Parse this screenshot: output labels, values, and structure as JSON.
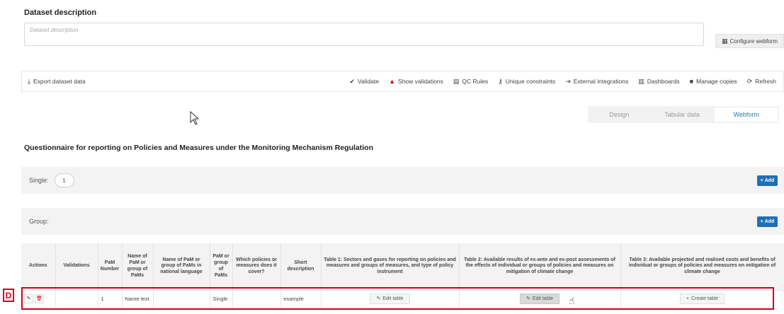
{
  "dataset": {
    "title": "Dataset description",
    "placeholder": "Dataset description",
    "configure_label": "Configure webform"
  },
  "toolbar": {
    "export_label": "Export dataset data",
    "items": [
      {
        "label": "Validate",
        "icon": "check-circle-icon"
      },
      {
        "label": "Show validations",
        "icon": "warning-icon"
      },
      {
        "label": "QC Rules",
        "icon": "document-icon"
      },
      {
        "label": "Unique constraints",
        "icon": "key-icon"
      },
      {
        "label": "External integrations",
        "icon": "plug-icon"
      },
      {
        "label": "Dashboards",
        "icon": "bar-chart-icon"
      },
      {
        "label": "Manage copies",
        "icon": "copy-icon"
      },
      {
        "label": "Refresh",
        "icon": "refresh-icon"
      }
    ]
  },
  "view_tabs": [
    {
      "label": "Design",
      "active": false
    },
    {
      "label": "Tabular data",
      "active": false
    },
    {
      "label": "Webform",
      "active": true
    }
  ],
  "questionnaire": {
    "title": "Questionnaire for reporting on Policies and Measures under the Monitoring Mechanism Regulation",
    "single_label": "Single:",
    "single_count": "1",
    "group_label": "Group:",
    "add_label": "Add"
  },
  "table": {
    "headers": [
      "Actions",
      "Validations",
      "PaM Number",
      "Name of PaM or group of PaMs",
      "Name of PaM or group of PaMs in national language",
      "PaM or group of PaMs",
      "Which policies or measures does it cover?",
      "Short description",
      "Table 1: Sectors and gases for reporting on policies and measures and groups of measures, and type of policy instrument",
      "Table 2: Available results of ex-ante and ex-post assessments of the effects of individual or groups of policies and measures on mitigation of climate change",
      "Table 3: Available projected and realised costs and benefits of individual or groups of policies and measures on mitigation of climate change"
    ],
    "row": {
      "validations": "",
      "pam_number": "1",
      "name": "Name test",
      "name_national": "",
      "type": "Single",
      "covers": "",
      "short_description": "example",
      "table1_btn": "Edit table",
      "table2_btn": "Edit table",
      "table3_btn": "Create table"
    }
  },
  "annotation": {
    "label": "D",
    "color": "#d0021b"
  },
  "colors": {
    "accent": "#1f6fb5",
    "active_tab": "#2a7ab8",
    "highlight": "#d0021b"
  }
}
